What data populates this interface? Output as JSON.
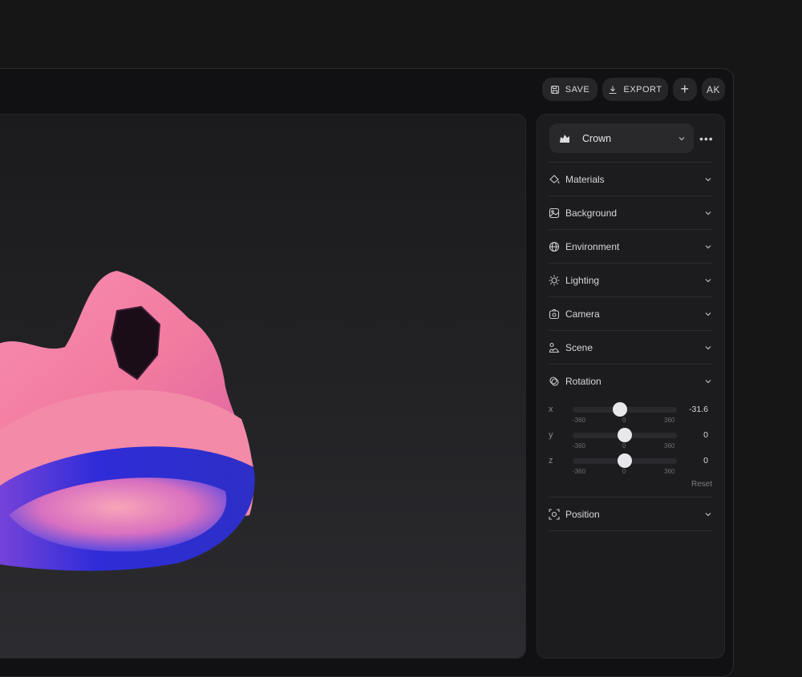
{
  "toolbar": {
    "save": "SAVE",
    "export": "EXPORT",
    "add": "+",
    "avatar": "AK"
  },
  "object": {
    "name": "Crown"
  },
  "sections": [
    {
      "label": "Materials",
      "icon": "paint-bucket-icon"
    },
    {
      "label": "Background",
      "icon": "image-icon"
    },
    {
      "label": "Environment",
      "icon": "globe-icon"
    },
    {
      "label": "Lighting",
      "icon": "sun-icon"
    },
    {
      "label": "Camera",
      "icon": "camera-icon"
    },
    {
      "label": "Scene",
      "icon": "scene-icon"
    },
    {
      "label": "Rotation",
      "icon": "rotate-icon"
    }
  ],
  "rotation": {
    "min": -360,
    "max": 360,
    "axes": [
      {
        "axis": "x",
        "value": "-31.6"
      },
      {
        "axis": "y",
        "value": "0"
      },
      {
        "axis": "z",
        "value": "0"
      }
    ],
    "ticks": [
      "-360",
      "0",
      "360"
    ],
    "reset": "Reset"
  },
  "position": {
    "label": "Position",
    "icon": "focus-icon"
  },
  "colors": {
    "accent_pink": "#f36fa0",
    "accent_blue": "#3a35e0"
  }
}
